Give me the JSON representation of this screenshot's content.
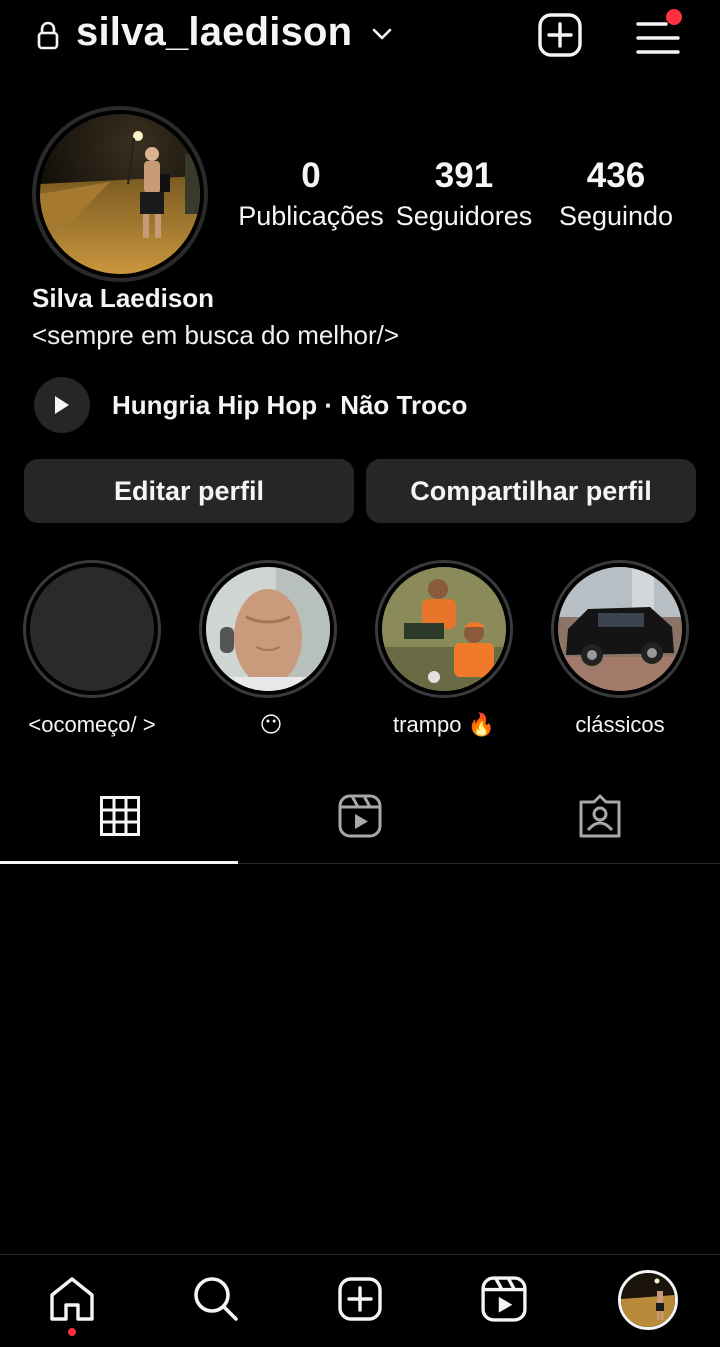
{
  "header": {
    "username": "silva_laedison",
    "has_notification": true
  },
  "profile": {
    "stats": [
      {
        "value": "0",
        "label": "Publicações"
      },
      {
        "value": "391",
        "label": "Seguidores"
      },
      {
        "value": "436",
        "label": "Seguindo"
      }
    ],
    "name": "Silva Laedison",
    "bio": "<sempre em busca do melhor/>",
    "music": "Hungria Hip Hop · Não Troco"
  },
  "buttons": {
    "edit": "Editar perfil",
    "share": "Compartilhar perfil"
  },
  "highlights": [
    {
      "label": "<ocomeço/ >",
      "emoji": ""
    },
    {
      "label": "",
      "emoji": "😶"
    },
    {
      "label": "trampo",
      "emoji": "🔥"
    },
    {
      "label": "clássicos",
      "emoji": ""
    }
  ],
  "tabs": [
    "grid-icon",
    "reels-icon",
    "tagged-icon"
  ],
  "bottom_nav": [
    "home-icon",
    "search-icon",
    "create-icon",
    "reels-icon",
    "profile-avatar"
  ],
  "colors": {
    "background": "#000000",
    "button": "#262626",
    "notification": "#ff3040",
    "text": "#f5f5f5"
  }
}
